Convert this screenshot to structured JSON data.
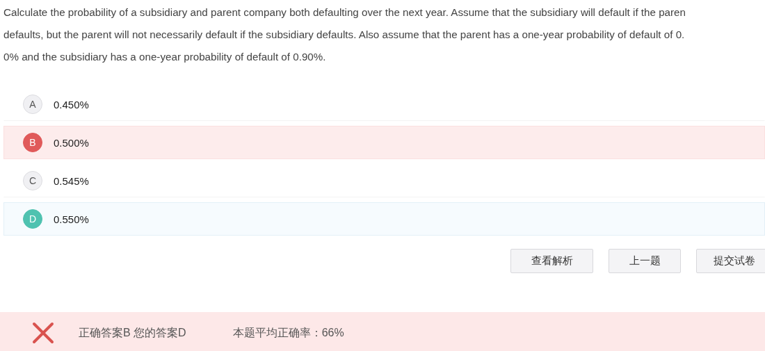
{
  "question": {
    "lines": [
      "Calculate the probability of a subsidiary and parent company both defaulting over the next year. Assume that the subsidiary will default if the paren",
      "defaults, but the parent will not necessarily default if the subsidiary defaults. Also assume that the parent has a one-year probability of default of 0.",
      "0% and the subsidiary has a one-year probability of default of 0.90%."
    ]
  },
  "options": [
    {
      "letter": "A",
      "text": "0.450%",
      "correct": false,
      "selected": false
    },
    {
      "letter": "B",
      "text": "0.500%",
      "correct": true,
      "selected": false
    },
    {
      "letter": "C",
      "text": "0.545%",
      "correct": false,
      "selected": false
    },
    {
      "letter": "D",
      "text": "0.550%",
      "correct": false,
      "selected": true
    }
  ],
  "buttons": [
    "查看解析",
    "上一题",
    "提交试卷"
  ],
  "result": {
    "is_correct": false,
    "answers": "正确答案B 您的答案D",
    "average": "本题平均正确率：66%"
  }
}
